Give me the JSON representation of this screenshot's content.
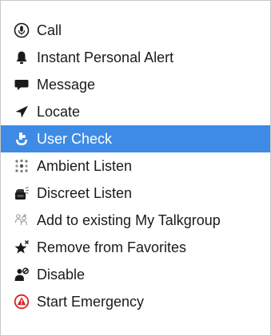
{
  "menu": {
    "items": [
      {
        "label": "Call",
        "icon": "microphone-circle-icon"
      },
      {
        "label": "Instant Personal Alert",
        "icon": "bell-icon"
      },
      {
        "label": "Message",
        "icon": "speech-bubble-icon"
      },
      {
        "label": "Locate",
        "icon": "location-arrow-icon"
      },
      {
        "label": "User Check",
        "icon": "user-check-icon",
        "selected": true
      },
      {
        "label": "Ambient Listen",
        "icon": "ambient-listen-icon"
      },
      {
        "label": "Discreet Listen",
        "icon": "discreet-listen-icon"
      },
      {
        "label": "Add to existing My Talkgroup",
        "icon": "add-talkgroup-icon"
      },
      {
        "label": "Remove from Favorites",
        "icon": "star-remove-icon"
      },
      {
        "label": "Disable",
        "icon": "user-disable-icon"
      },
      {
        "label": "Start Emergency",
        "icon": "emergency-alert-icon"
      }
    ]
  },
  "colors": {
    "selected_background": "#3e8be6",
    "icon_dark": "#1a1a1a",
    "emergency_red": "#e02020"
  }
}
